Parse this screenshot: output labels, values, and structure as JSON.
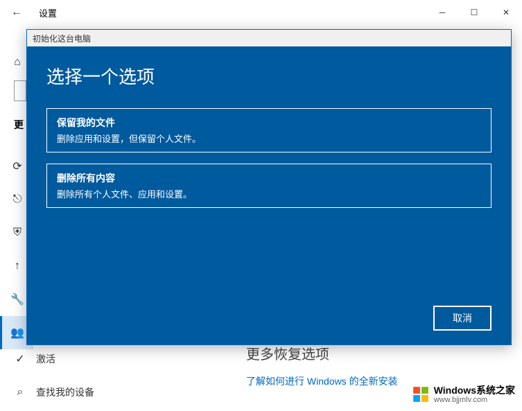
{
  "window": {
    "title": "设置",
    "back_icon": "←",
    "minimize": "─",
    "maximize": "☐",
    "close": "✕"
  },
  "sidebar": {
    "update_label": "更",
    "items": [
      {
        "icon": "⌂",
        "label": ""
      },
      {
        "icon": "⟳",
        "label": ""
      },
      {
        "icon": "⎋",
        "label": ""
      },
      {
        "icon": "⛨",
        "label": ""
      },
      {
        "icon": "↑",
        "label": ""
      },
      {
        "icon": "🔧",
        "label": ""
      },
      {
        "icon": "👥",
        "label": ""
      }
    ],
    "activation": {
      "icon": "✓",
      "label": "激活"
    },
    "find_device": {
      "icon": "⌕",
      "label": "查找我的设备"
    }
  },
  "main": {
    "more_recovery": "更多恢复选项",
    "link": "了解如何进行 Windows 的全新安装"
  },
  "dialog": {
    "titlebar": "初始化这台电脑",
    "heading": "选择一个选项",
    "option1": {
      "title": "保留我的文件",
      "desc": "删除应用和设置，但保留个人文件。"
    },
    "option2": {
      "title": "删除所有内容",
      "desc": "删除所有个人文件、应用和设置。"
    },
    "cancel": "取消"
  },
  "watermark": {
    "title": "Windows系统之家",
    "url": "www.bjjmlv.com"
  }
}
